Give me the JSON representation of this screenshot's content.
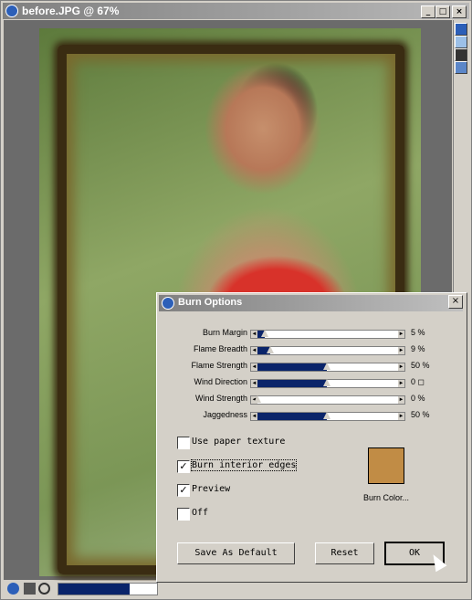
{
  "window": {
    "title": "before.JPG @ 67%",
    "min_label": "_",
    "max_label": "□",
    "close_label": "×"
  },
  "dialog": {
    "title": "Burn Options",
    "close_label": "×",
    "sliders": [
      {
        "label": "Burn Margin",
        "value": 5,
        "value_text": "5 %"
      },
      {
        "label": "Flame Breadth",
        "value": 9,
        "value_text": "9 %"
      },
      {
        "label": "Flame Strength",
        "value": 50,
        "value_text": "50 %"
      },
      {
        "label": "Wind Direction",
        "value": 50,
        "value_text": "0 ◻"
      },
      {
        "label": "Wind Strength",
        "value": 0,
        "value_text": "0 %"
      },
      {
        "label": "Jaggedness",
        "value": 50,
        "value_text": "50 %"
      }
    ],
    "checkboxes": [
      {
        "label": "Use paper texture",
        "checked": false
      },
      {
        "label": "Burn interior edges",
        "checked": true
      },
      {
        "label": "Preview",
        "checked": true
      },
      {
        "label": "Off",
        "checked": false
      }
    ],
    "burn_color": "#c18c45",
    "burn_color_label": "Burn Color...",
    "buttons": {
      "save_default": "Save As Default",
      "reset": "Reset",
      "ok": "OK"
    }
  },
  "status": {
    "scroll_position": 0.72
  }
}
